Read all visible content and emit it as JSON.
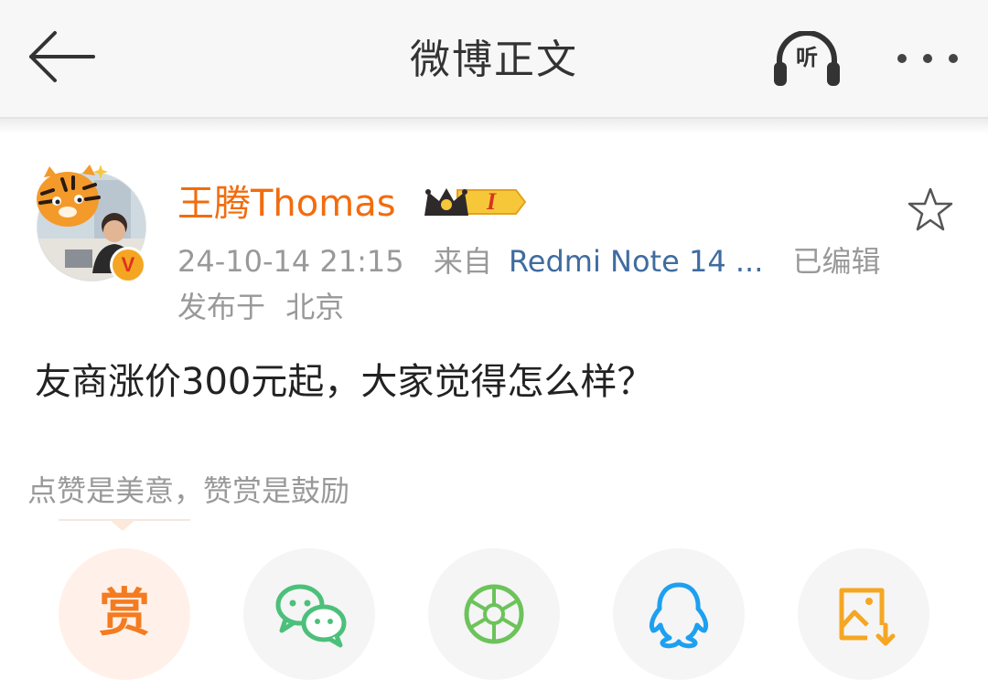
{
  "header": {
    "title": "微博正文",
    "listen_label": "听"
  },
  "post": {
    "author": {
      "name": "王腾Thomas",
      "verified_badge": "V",
      "vip_level": "I"
    },
    "timestamp": "24-10-14 21:15",
    "from_label": "来自",
    "device": "Redmi Note 14 ...",
    "edited_label": "已编辑",
    "location_prefix": "发布于",
    "location": "北京",
    "text": "友商涨价300元起，大家觉得怎么样？"
  },
  "reward": {
    "hint": "点赞是美意，赞赏是鼓励",
    "reward_char": "赏"
  },
  "share_targets": [
    "reward",
    "wechat",
    "moments",
    "qq",
    "save-image"
  ],
  "colors": {
    "accent_orange": "#f26c0d",
    "link_blue": "#3f6ca0",
    "meta_gray": "#999999",
    "wechat_green": "#4cc07a",
    "qq_blue": "#1ea0f0",
    "save_orange": "#f5a623"
  }
}
